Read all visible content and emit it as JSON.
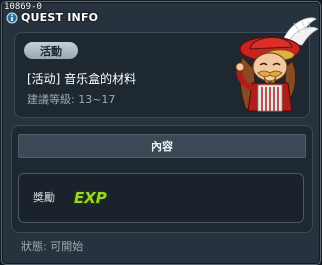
{
  "window": {
    "quest_id": "10869-0",
    "title": "QUEST INFO"
  },
  "quest": {
    "category": "活動",
    "name": "[活动] 音乐盒的材料",
    "level": "建議等級: 13~17",
    "npc_icon": "jester-npc-portrait"
  },
  "content": {
    "header": "內容",
    "reward_label": "獎勵",
    "reward_icon": "exp-icon",
    "reward_text": "EXP"
  },
  "status": "狀態: 可開始",
  "colors": {
    "window_bg": "#26323d",
    "panel_bg": "#1e2830",
    "exp_green": "#9bd42a",
    "text_muted": "#9ea9b3"
  }
}
